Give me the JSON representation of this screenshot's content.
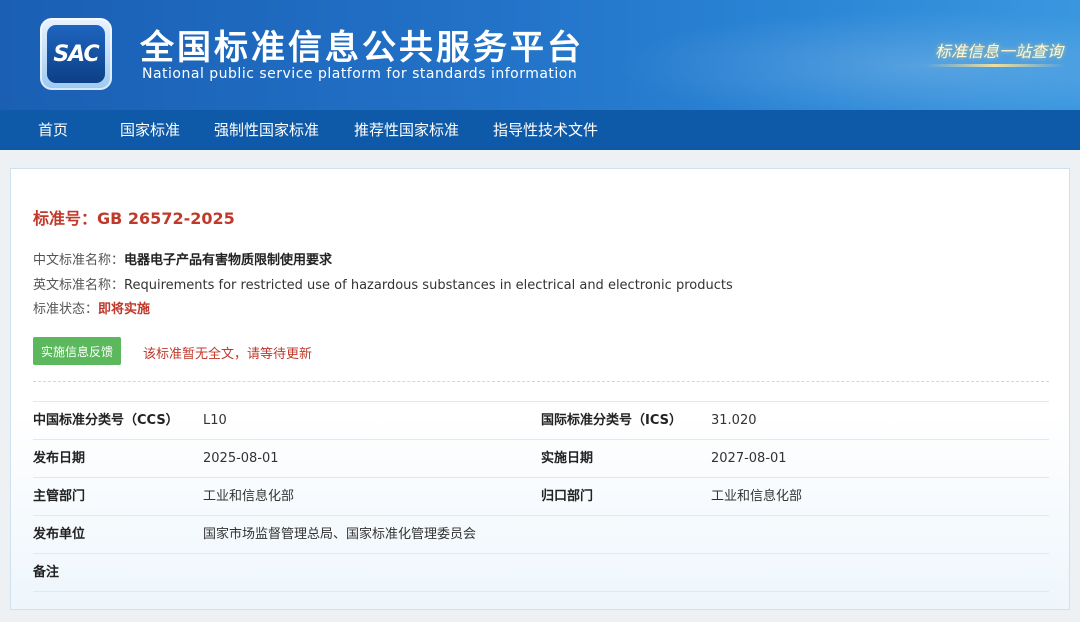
{
  "header": {
    "logo_text": "SAC",
    "title_zh": "全国标准信息公共服务平台",
    "title_en": "National public service platform  for standards information",
    "slogan": "标准信息一站查询"
  },
  "nav": {
    "items": [
      {
        "label": "首页"
      },
      {
        "label": "国家标准"
      },
      {
        "label": "强制性国家标准"
      },
      {
        "label": "推荐性国家标准"
      },
      {
        "label": "指导性技术文件"
      }
    ]
  },
  "standard": {
    "number_label": "标准号：",
    "number": "GB 26572-2025",
    "cn_name_label": "中文标准名称：",
    "cn_name": "电器电子产品有害物质限制使用要求",
    "en_name_label": "英文标准名称：",
    "en_name": "Requirements for restricted use of hazardous substances in electrical and electronic products",
    "status_label": "标准状态：",
    "status": "即将实施",
    "feedback_button": "实施信息反馈",
    "notice": "该标准暂无全文，请等待更新"
  },
  "details": [
    {
      "label1": "中国标准分类号（CCS）",
      "value1": "L10",
      "label2": "国际标准分类号（ICS）",
      "value2": "31.020"
    },
    {
      "label1": "发布日期",
      "value1": "2025-08-01",
      "label2": "实施日期",
      "value2": "2027-08-01"
    },
    {
      "label1": "主管部门",
      "value1": "工业和信息化部",
      "label2": "归口部门",
      "value2": "工业和信息化部"
    },
    {
      "label1": "发布单位",
      "value1": "国家市场监督管理总局、国家标准化管理委员会",
      "label2": "",
      "value2": ""
    },
    {
      "label1": "备注",
      "value1": "",
      "label2": "",
      "value2": ""
    }
  ]
}
